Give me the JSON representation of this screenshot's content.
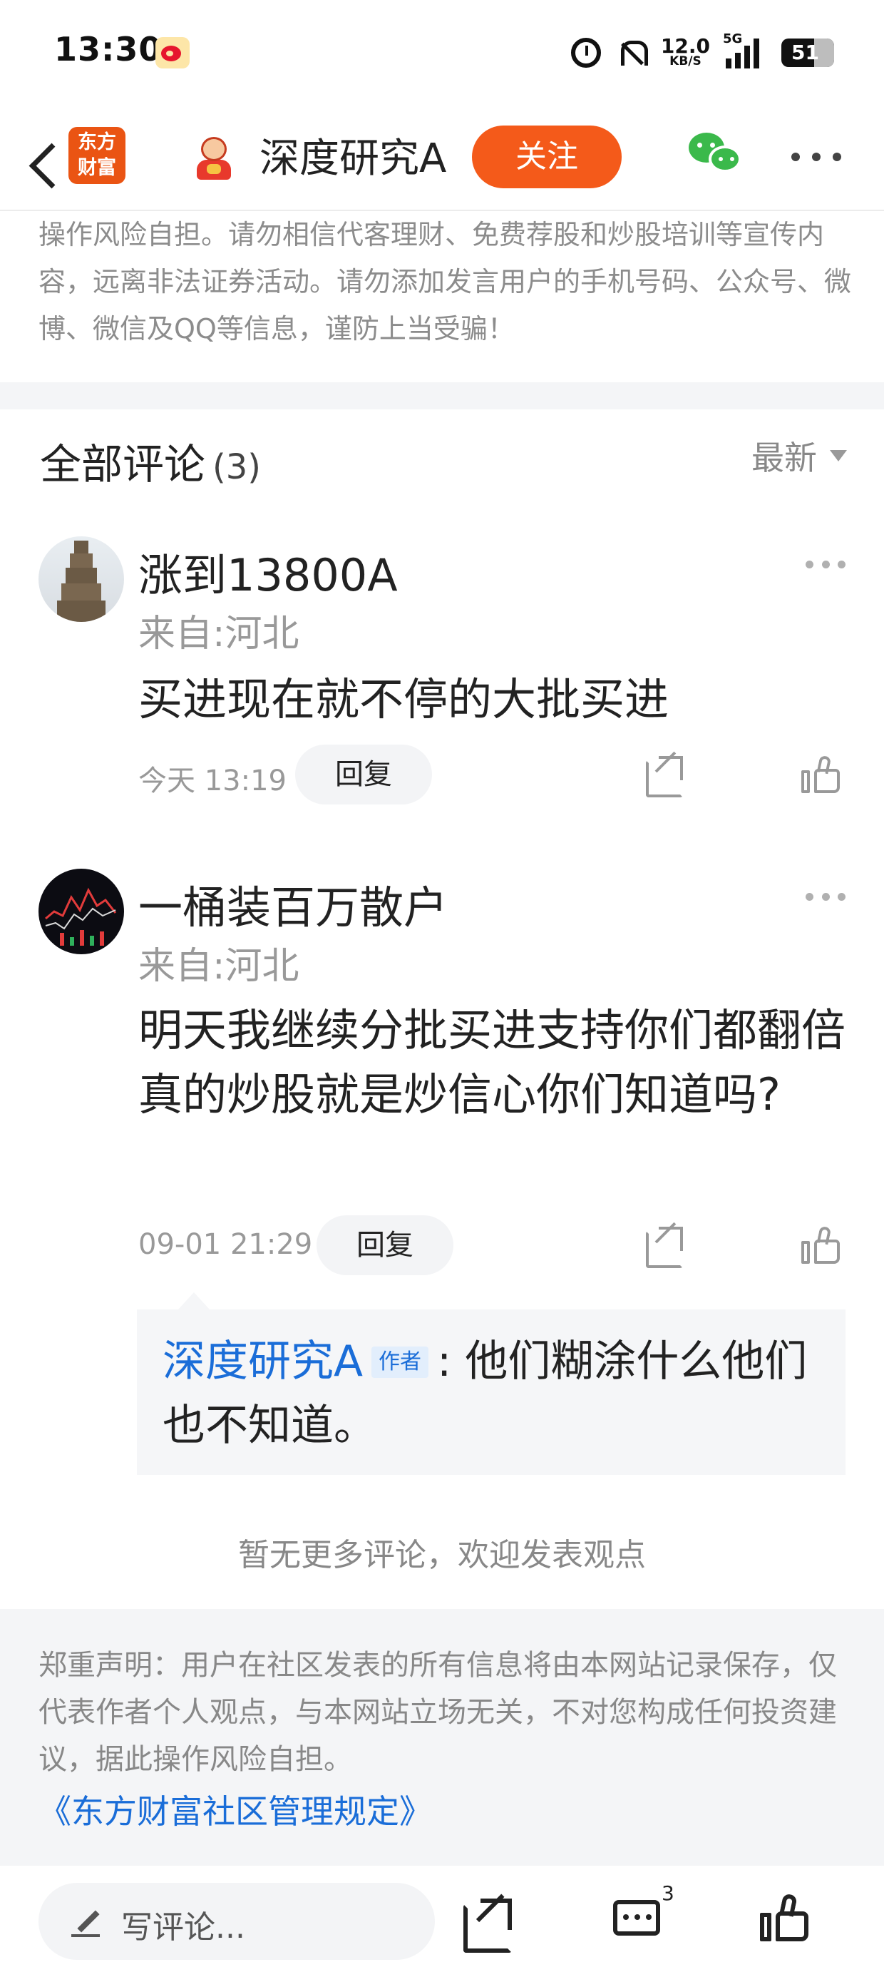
{
  "status_bar": {
    "time": "13:30",
    "net_speed": "12.0",
    "net_unit": "KB/S",
    "network": "5G",
    "battery": "51"
  },
  "header": {
    "logo_text": "东方\n财富",
    "title": "深度研究A",
    "follow_label": "关注"
  },
  "risk_notice": "操作风险自担。请勿相信代客理财、免费荐股和炒股培训等宣传内容，远离非法证券活动。请勿添加发言用户的手机号码、公众号、微博、微信及QQ等信息，谨防上当受骗！",
  "comments_section": {
    "title": "全部评论",
    "count": "(3)",
    "sort_label": "最新"
  },
  "comments": [
    {
      "username": "涨到13800A",
      "location": "来自:河北",
      "text": "买进现在就不停的大批买进",
      "time": "今天 13:19",
      "reply_label": "回复"
    },
    {
      "username": "一桶装百万散户",
      "location": "来自:河北",
      "text": "明天我继续分批买进支持你们都翻倍真的炒股就是炒信心你们知道吗?",
      "time": "09-01 21:29",
      "reply_label": "回复",
      "reply": {
        "author": "深度研究A",
        "tag": "作者",
        "text": ": 他们糊涂什么他们也不知道。"
      }
    }
  ],
  "no_more_text": "暂无更多评论，欢迎发表观点",
  "footer_disclaimer": {
    "text": "郑重声明：用户在社区发表的所有信息将由本网站记录保存，仅代表作者个人观点，与本网站立场无关，不对您构成任何投资建议，据此操作风险自担。",
    "link": "《东方财富社区管理规定》"
  },
  "bottom_bar": {
    "input_placeholder": "写评论...",
    "comment_count": "3"
  },
  "colors": {
    "accent": "#f45a1a",
    "link": "#1a6dd8",
    "logo": "#ea5413",
    "wechat": "#3bb94b"
  }
}
